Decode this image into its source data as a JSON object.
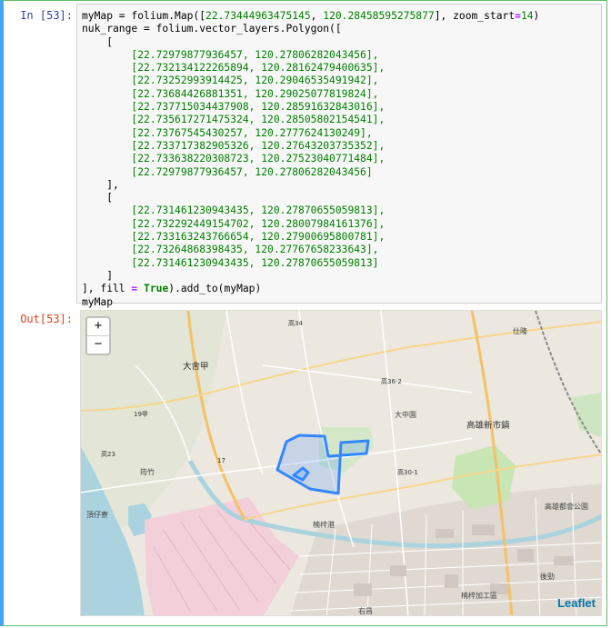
{
  "notebook": {
    "in_prompt": "In [53]:",
    "out_prompt": "Out[53]:",
    "code": {
      "line1_a": "myMap = folium.Map([",
      "line1_lat": "22.73444963475145",
      "line1_sep": ", ",
      "line1_lon": "120.28458595275877",
      "line1_b": "], zoom_start",
      "line1_eq": "=",
      "line1_zoom": "14",
      "line1_c": ")",
      "line2": "nuk_range = folium.vector_layers.Polygon([",
      "line3": "    [",
      "ring1": [
        "        [22.72979877936457, 120.27806282043456],",
        "        [22.732134122265894, 120.28162479400635],",
        "        [22.73252993914425, 120.29046535491942],",
        "        [22.73684426881351, 120.29025077819824],",
        "        [22.737715034437908, 120.28591632843016],",
        "        [22.735617271475324, 120.28505802154541],",
        "        [22.73767545430257, 120.2777624130249],",
        "        [22.733717382905326, 120.27643203735352],",
        "        [22.733638220308723, 120.27523040771484],",
        "        [22.72979877936457, 120.27806282043456]"
      ],
      "line_close1": "    ],",
      "line_open2": "    [",
      "ring2": [
        "        [22.731461230943435, 120.27870655059813],",
        "        [22.732292449154702, 120.28007984161376],",
        "        [22.733163243766654, 120.27900695800781],",
        "        [22.73264868398435, 120.27767658233643],",
        "        [22.731461230943435, 120.27870655059813]"
      ],
      "line_close2": "    ]",
      "last_a": "], fill ",
      "last_eq": "=",
      "last_true": "True",
      "last_b": ").add_to(myMap)",
      "final": "myMap"
    }
  },
  "map": {
    "zoom_in": "+",
    "zoom_out": "−",
    "attribution": "Leaflet",
    "polygon_color": "#3388ff",
    "labels": {
      "dashe": "大舍甲",
      "nanzi_new": "高雄新市鎮",
      "dashe_garden": "大中園",
      "sheyang": "頂仔寮",
      "linyuan": "楠梓港",
      "oceanroad": "後勁",
      "houjin": "右昌",
      "road_19": "19甲",
      "road_17": "17",
      "road_23": "高23",
      "road_36": "高36-2",
      "road_34": "高34",
      "road_30": "高30-1",
      "shizhu": "仕隆",
      "tonglong": "筠竹",
      "hzp": "楠梓加工區",
      "zoo": "高雄都會公園"
    }
  }
}
